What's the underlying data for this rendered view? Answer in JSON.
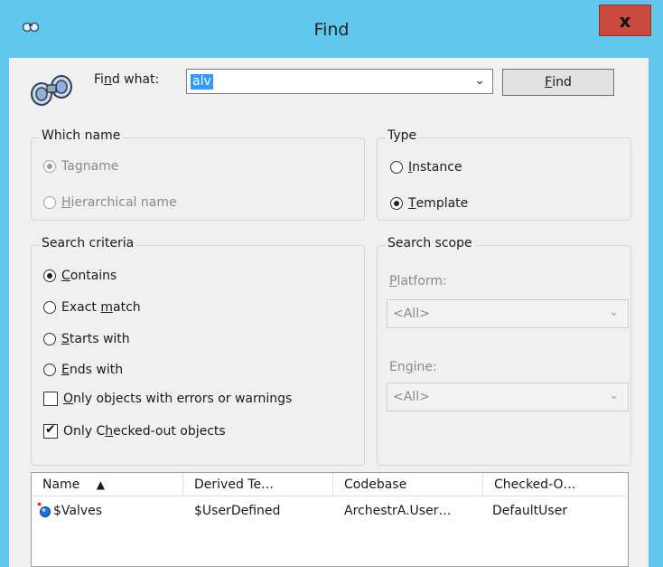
{
  "window": {
    "title": "Find",
    "close_label": "x",
    "accent_color": "#61c8ed",
    "close_color": "#c94b3f"
  },
  "find": {
    "label_pre": "Fi",
    "label_access": "n",
    "label_post": "d what:",
    "value": "alv",
    "button_access": "F",
    "button_rest": "ind"
  },
  "which_name": {
    "legend": "Which name",
    "tagname_pre": "Ta",
    "tagname_access": "g",
    "tagname_post": "name",
    "tagname_selected": true,
    "hierarchical_access": "H",
    "hierarchical_post": "ierarchical name",
    "hierarchical_selected": false,
    "disabled": true
  },
  "type": {
    "legend": "Type",
    "instance_access": "I",
    "instance_post": "nstance",
    "instance_selected": false,
    "template_access": "T",
    "template_post": "emplate",
    "template_selected": true
  },
  "search_criteria": {
    "legend": "Search criteria",
    "contains_access": "C",
    "contains_post": "ontains",
    "exact_pre": "Exact ",
    "exact_access": "m",
    "exact_post": "atch",
    "starts_access": "S",
    "starts_post": "tarts with",
    "ends_access": "E",
    "ends_post": "nds with",
    "selected": "Contains",
    "errors_access": "O",
    "errors_post": "nly objects with errors or warnings",
    "errors_checked": false,
    "checked_out_pre": "Only C",
    "checked_out_access": "h",
    "checked_out_post": "ecked-out objects",
    "checked_out_checked": true
  },
  "search_scope": {
    "legend": "Search scope",
    "platform_access": "P",
    "platform_post": "latform:",
    "platform_value": "<All>",
    "engine_pre": "En",
    "engine_access": "g",
    "engine_post": "ine:",
    "engine_value": "<All>"
  },
  "results": {
    "columns": [
      "Name",
      "Derived Te…",
      "Codebase",
      "Checked-O…"
    ],
    "sort_indicator": "▲",
    "rows": [
      {
        "name": "$Valves",
        "derived": "$UserDefined",
        "codebase": "ArchestrA.User…",
        "checked_out": "DefaultUser"
      }
    ]
  }
}
